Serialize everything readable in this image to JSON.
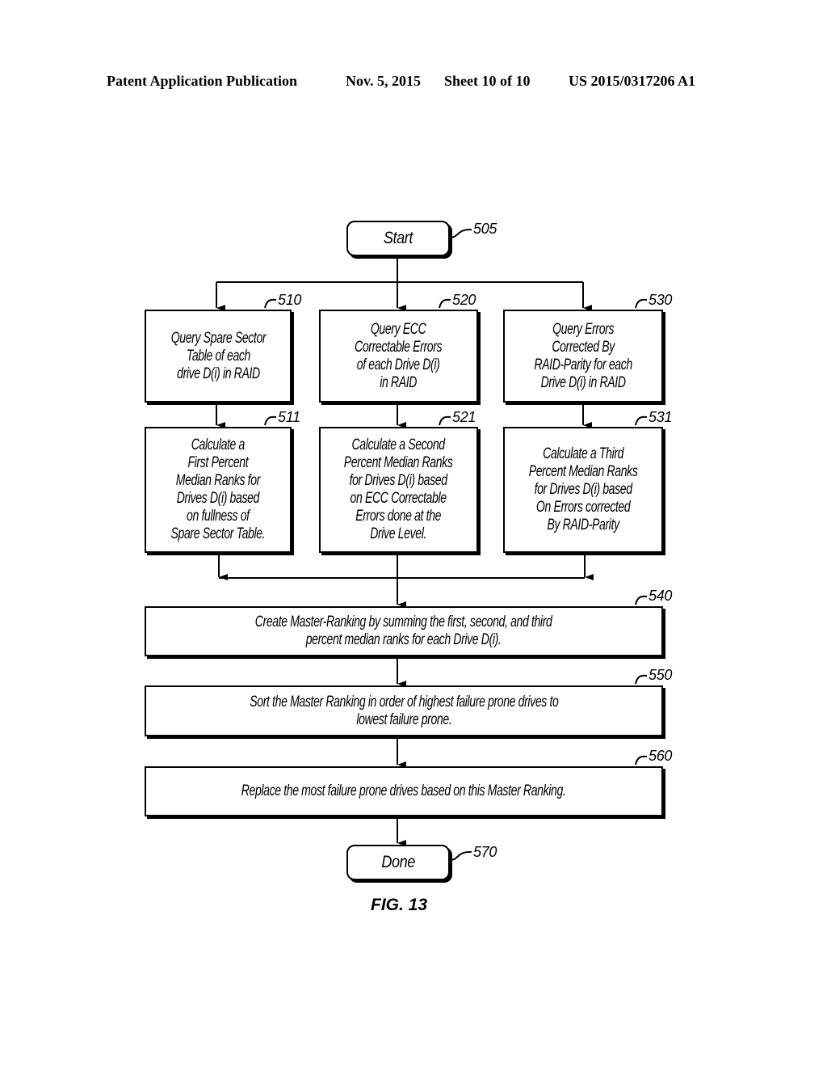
{
  "header": {
    "publication": "Patent Application Publication",
    "date": "Nov. 5, 2015",
    "sheet": "Sheet 10 of 10",
    "number": "US 2015/0317206 A1"
  },
  "figure_label": "FIG. 13",
  "nodes": {
    "start": {
      "ref": "505",
      "text": "Start"
    },
    "query_spare": {
      "ref": "510",
      "lines": [
        "Query Spare Sector",
        "Table of each",
        "drive D(i) in RAID"
      ]
    },
    "query_ecc": {
      "ref": "520",
      "lines": [
        "Query ECC",
        "Correctable Errors",
        "of each Drive D(i)",
        "in RAID"
      ]
    },
    "query_parity": {
      "ref": "530",
      "lines": [
        "Query Errors",
        "Corrected By",
        "RAID-Parity for each",
        "Drive D(i) in RAID"
      ]
    },
    "calc_first": {
      "ref": "511",
      "lines": [
        "Calculate a",
        "First Percent",
        "Median Ranks for",
        "Drives D(i) based",
        "on fullness of",
        "Spare Sector Table."
      ]
    },
    "calc_second": {
      "ref": "521",
      "lines": [
        "Calculate a Second",
        "Percent Median Ranks",
        "for Drives D(i) based",
        "on ECC Correctable",
        "Errors done at the",
        "Drive Level."
      ]
    },
    "calc_third": {
      "ref": "531",
      "lines": [
        "Calculate a Third",
        "Percent Median Ranks",
        "for Drives D(i) based",
        "On Errors corrected",
        "By RAID-Parity"
      ]
    },
    "master": {
      "ref": "540",
      "lines": [
        "Create Master-Ranking by summing the first, second, and third",
        "percent median ranks for each Drive D(i)."
      ]
    },
    "sort": {
      "ref": "550",
      "lines": [
        "Sort the Master Ranking in order of highest failure prone drives to",
        "lowest failure prone."
      ]
    },
    "replace": {
      "ref": "560",
      "lines": [
        "Replace the most failure prone drives based on this Master Ranking."
      ]
    },
    "done": {
      "ref": "570",
      "text": "Done"
    }
  }
}
